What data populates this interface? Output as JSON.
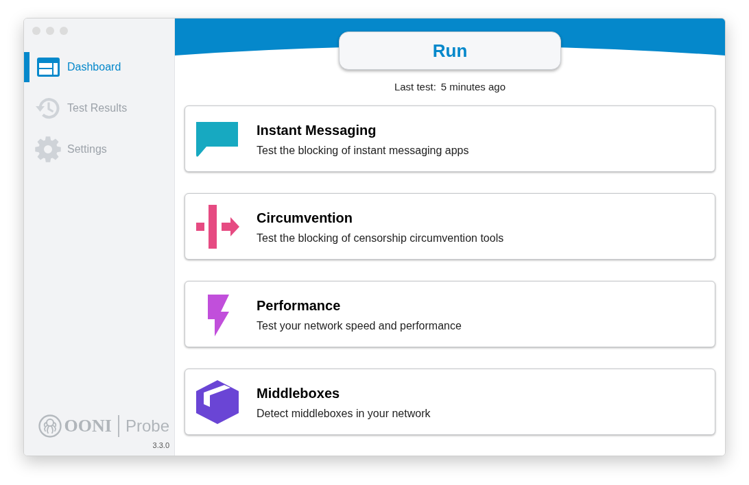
{
  "sidebar": {
    "items": [
      {
        "label": "Dashboard",
        "selected": true
      },
      {
        "label": "Test Results",
        "selected": false
      },
      {
        "label": "Settings",
        "selected": false
      }
    ],
    "logo": {
      "brand": "OONI",
      "product": "Probe"
    },
    "version": "3.3.0"
  },
  "header": {
    "run_button": "Run",
    "last_test": {
      "label": "Last test:",
      "value": "5 minutes ago"
    }
  },
  "tests": [
    {
      "title": "Instant Messaging",
      "description": "Test the blocking of instant messaging apps",
      "color": "#17a9c1"
    },
    {
      "title": "Circumvention",
      "description": "Test the blocking of censorship circumvention tools",
      "color": "#e64b82"
    },
    {
      "title": "Performance",
      "description": "Test your network speed and performance",
      "color": "#c14fdb"
    },
    {
      "title": "Middleboxes",
      "description": "Detect middleboxes in your network",
      "color": "#6a45d5"
    }
  ]
}
